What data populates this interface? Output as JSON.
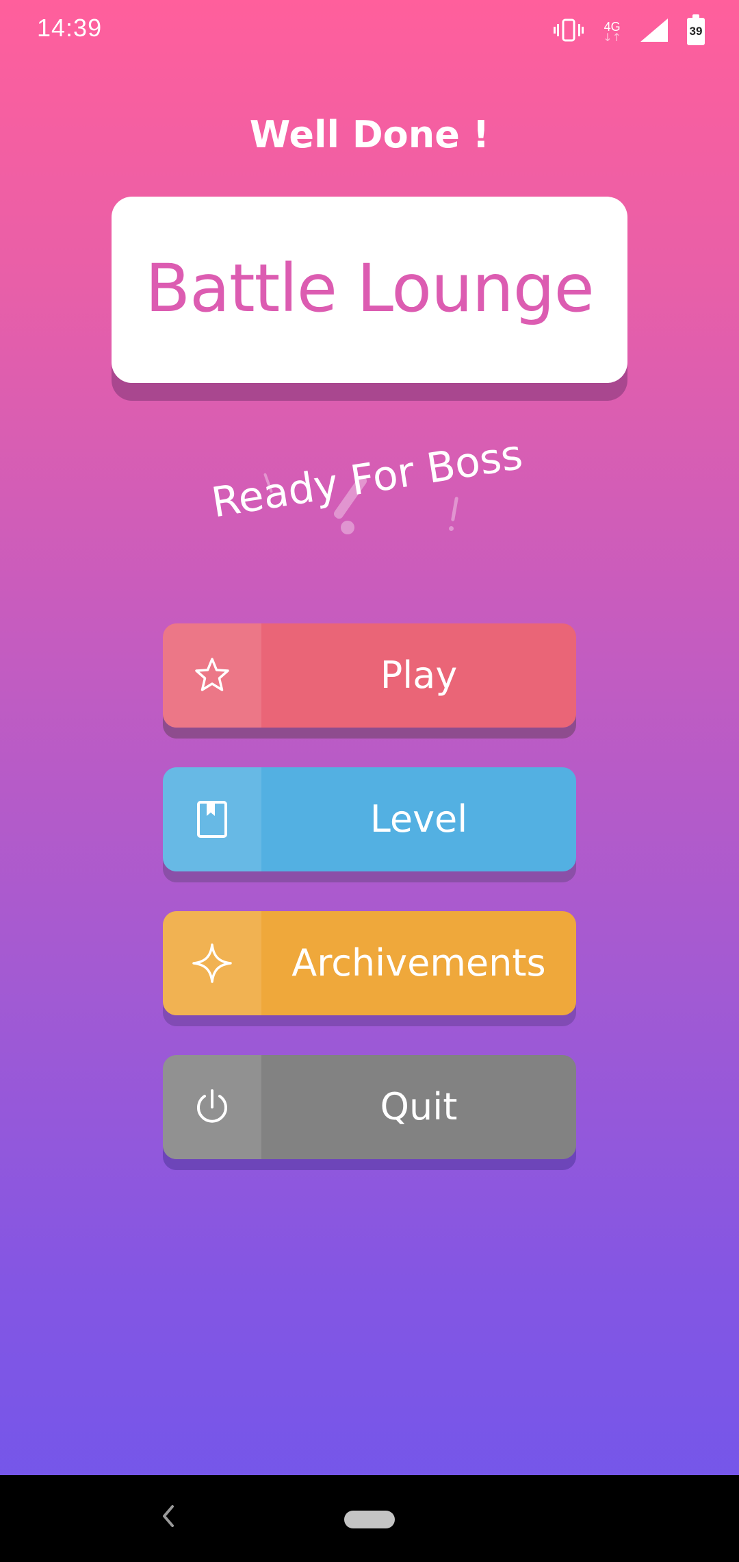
{
  "status_bar": {
    "time": "14:39",
    "network_label": "4G",
    "network_arrows": "↓↑",
    "battery_level": "39"
  },
  "header": {
    "title": "Well Done !"
  },
  "logo": {
    "text": "Battle Lounge"
  },
  "subtitle": {
    "text": "Ready For Boss"
  },
  "menu": {
    "items": [
      {
        "label": "Play",
        "icon": "star-icon",
        "color": "#ea6577"
      },
      {
        "label": "Level",
        "icon": "book-icon",
        "color": "#53b0e2"
      },
      {
        "label": "Archivements",
        "icon": "sparkle-icon",
        "color": "#efa83b"
      },
      {
        "label": "Quit",
        "icon": "power-icon",
        "color": "#828282"
      }
    ]
  },
  "colors": {
    "gradient_top": "#ff5f9c",
    "gradient_bottom": "#6f57ec",
    "logo_text": "#dc5cb1"
  }
}
